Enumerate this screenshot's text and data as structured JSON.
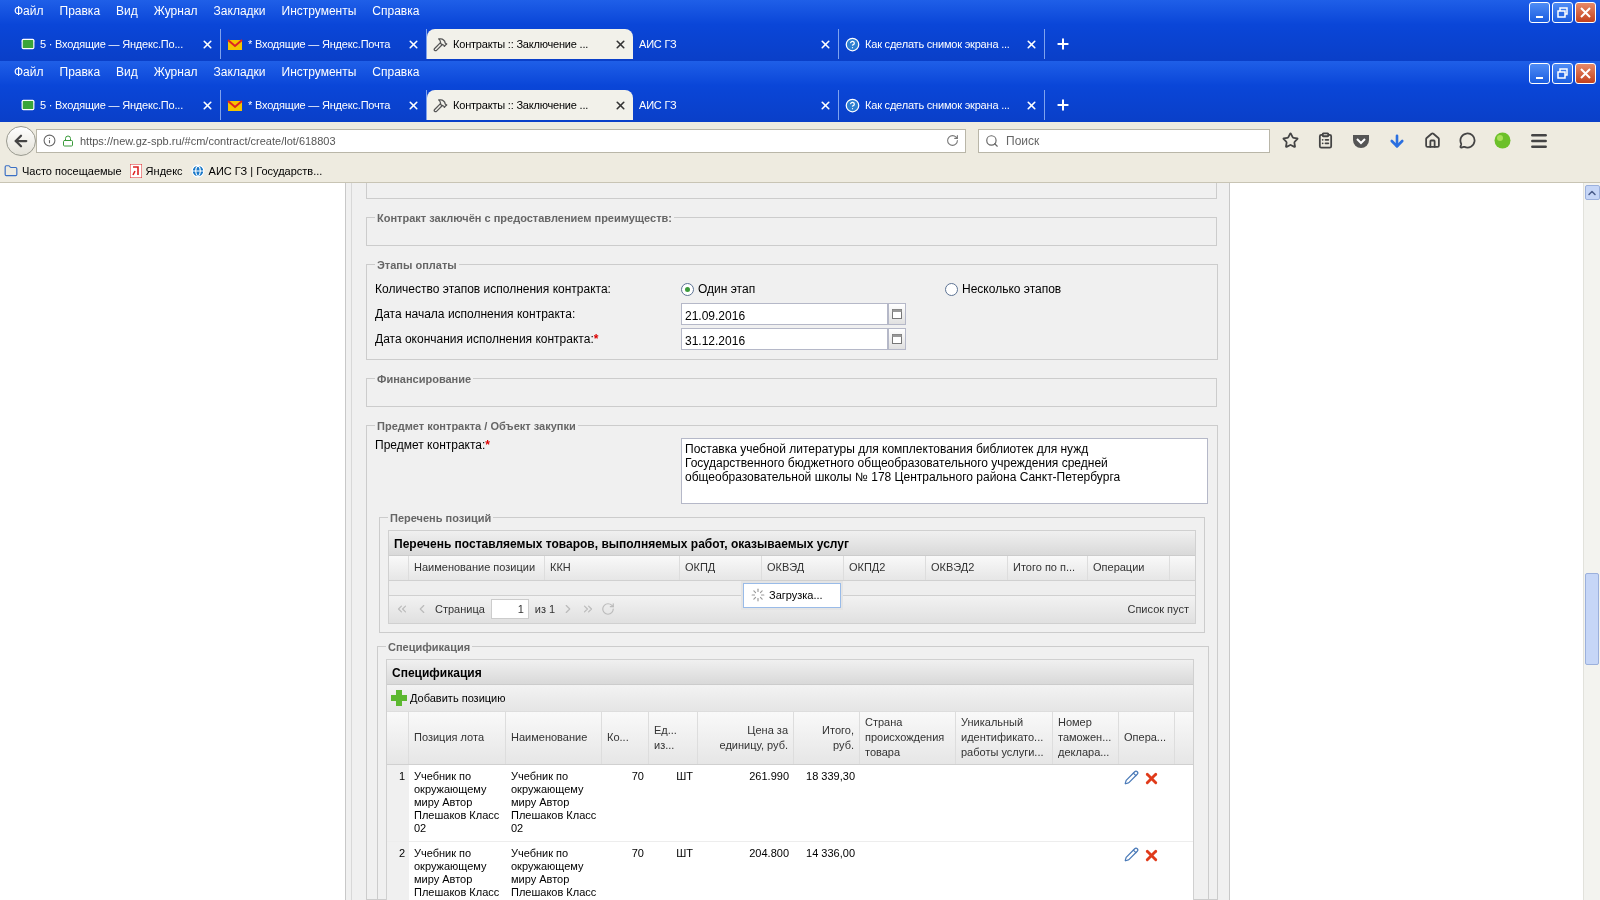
{
  "chrome_copies": [
    {
      "menu": [
        "Файл",
        "Правка",
        "Вид",
        "Журнал",
        "Закладки",
        "Инструменты",
        "Справка"
      ],
      "tabs": [
        {
          "label": "5 · Входящие — Яндекс.По...",
          "kind": "mail-green",
          "selected": false
        },
        {
          "label": "* Входящие — Яндекс.Почта",
          "kind": "mail-yellow",
          "selected": false
        },
        {
          "label": "Контракты :: Заключение ...",
          "kind": "hammer",
          "selected": true
        },
        {
          "label": "АИС ГЗ",
          "kind": "plain",
          "selected": false
        },
        {
          "label": "Как сделать снимок экрана ...",
          "kind": "help",
          "selected": false
        }
      ]
    },
    {
      "menu": [
        "Файл",
        "Правка",
        "Вид",
        "Журнал",
        "Закладки",
        "Инструменты",
        "Справка"
      ],
      "tabs": [
        {
          "label": "5 · Входящие — Яндекс.По...",
          "kind": "mail-green",
          "selected": false
        },
        {
          "label": "* Входящие — Яндекс.Почта",
          "kind": "mail-yellow",
          "selected": false
        },
        {
          "label": "Контракты :: Заключение ...",
          "kind": "hammer",
          "selected": true
        },
        {
          "label": "АИС ГЗ",
          "kind": "plain",
          "selected": false
        },
        {
          "label": "Как сделать снимок экрана ...",
          "kind": "help",
          "selected": false
        }
      ]
    }
  ],
  "address_bar": {
    "url": "https://new.gz-spb.ru/#cm/contract/create/lot/618803",
    "search_placeholder": "Поиск"
  },
  "bookmarks": [
    {
      "label": "Часто посещаемые",
      "kind": "folder"
    },
    {
      "label": "Яндекс",
      "kind": "yandex"
    },
    {
      "label": "АИС ГЗ | Государств...",
      "kind": "globe"
    }
  ],
  "form": {
    "advantages_section": {
      "title": "Контракт заключён с предоставлением преимуществ:"
    },
    "payment_section": {
      "title": "Этапы оплаты",
      "stages": {
        "label": "Количество этапов исполнения контракта:",
        "options": [
          {
            "label": "Один этап",
            "selected": true
          },
          {
            "label": "Несколько этапов",
            "selected": false
          }
        ]
      },
      "dates": [
        {
          "label": "Дата начала исполнения контракта:",
          "value": "21.09.2016"
        },
        {
          "label": "Дата окончания исполнения контракта:",
          "required_mark": "*",
          "value": "31.12.2016"
        }
      ]
    },
    "financing_section": {
      "title": "Финансирование"
    },
    "subject_section": {
      "title": "Предмет контракта / Объект закупки",
      "subject": {
        "label": "Предмет контракта:",
        "required_mark": "*",
        "value": "Поставка учебной литературы для комплектования библиотек для нужд\nГосударственного бюджетного общеобразовательного учреждения средней\nобщеобразовательной школы № 178 Центрального района Санкт-Петербурга"
      },
      "positions": {
        "title": "Перечень позиций",
        "grid_title": "Перечень поставляемых товаров, выполняемых работ, оказываемых услуг",
        "columns": [
          "Наименование позиции",
          "ККН",
          "ОКПД",
          "ОКВЭД",
          "ОКПД2",
          "ОКВЭД2",
          "Итого по п...",
          "Операции"
        ],
        "pager": {
          "page_label": "Страница",
          "page": "1",
          "of": "из 1",
          "status": "Список пуст"
        },
        "loading": "Загрузка..."
      }
    },
    "specification_section": {
      "title": "Спецификация",
      "grid_title": "Спецификация",
      "add_button": "Добавить позицию",
      "columns": [
        {
          "label": "Позиция лота",
          "kind": "text"
        },
        {
          "label": "Наименование",
          "kind": "text"
        },
        {
          "label": "Ко...",
          "kind": "text"
        },
        {
          "label": "Ед...\nиз...",
          "kind": "text"
        },
        {
          "label": "Цена за\nединицу, руб.",
          "kind": "number"
        },
        {
          "label": "Итого,\nруб.",
          "kind": "number"
        },
        {
          "label": "Страна\nпроисхождения\nтовара",
          "kind": "text"
        },
        {
          "label": "Уникальный\nидентификато...\nработы услуги...",
          "kind": "text"
        },
        {
          "label": "Номер\nтаможен...\nдеклара...",
          "kind": "text"
        },
        {
          "label": "Опера...",
          "kind": "text"
        }
      ],
      "rows": [
        {
          "number": "1",
          "cells": [
            "Учебник по окружающему миру Автор Плешаков Класс 02",
            "Учебник по окружающему миру Автор Плешаков Класс 02",
            "70",
            "ШТ",
            "261.990",
            "18 339,30"
          ]
        },
        {
          "number": "2",
          "cells": [
            "Учебник по окружающему миру Автор Плешаков Класс",
            "Учебник по окружающему миру Автор Плешаков Класс",
            "70",
            "ШТ",
            "204.800",
            "14 336,00"
          ]
        }
      ]
    }
  }
}
